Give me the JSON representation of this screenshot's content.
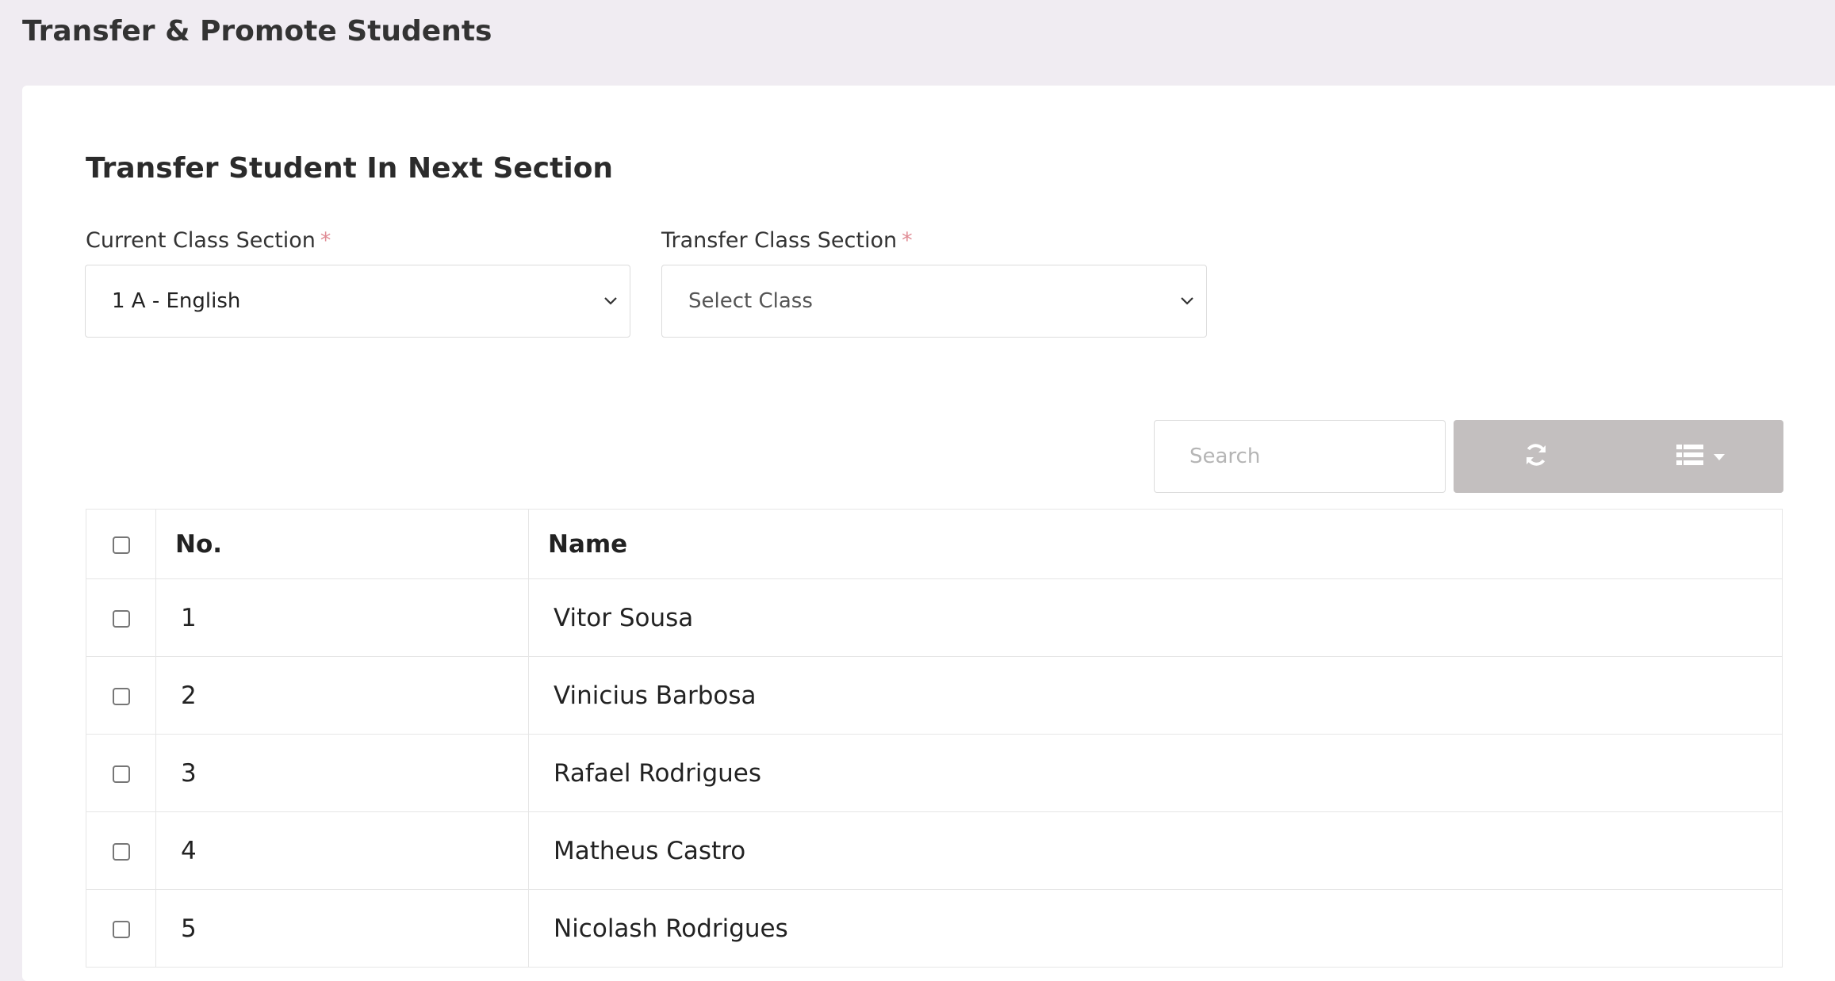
{
  "page": {
    "title": "Transfer & Promote Students"
  },
  "card": {
    "title": "Transfer Student In Next Section",
    "current_class": {
      "label": "Current Class Section",
      "required_mark": "*",
      "value": "1 A - English"
    },
    "transfer_class": {
      "label": "Transfer Class Section",
      "required_mark": "*",
      "value": "Select Class"
    }
  },
  "toolbar": {
    "search_placeholder": "Search",
    "refresh_icon": "refresh-icon",
    "columns_icon": "list-columns-icon"
  },
  "table": {
    "headers": {
      "no": "No.",
      "name": "Name"
    },
    "rows": [
      {
        "no": "1",
        "name": "Vitor Sousa"
      },
      {
        "no": "2",
        "name": "Vinicius Barbosa"
      },
      {
        "no": "3",
        "name": "Rafael Rodrigues"
      },
      {
        "no": "4",
        "name": "Matheus Castro"
      },
      {
        "no": "5",
        "name": "Nicolash Rodrigues"
      }
    ]
  },
  "colors": {
    "background": "#f0ecf2",
    "button_group": "#c3bfbf",
    "required": "#e08c95"
  }
}
